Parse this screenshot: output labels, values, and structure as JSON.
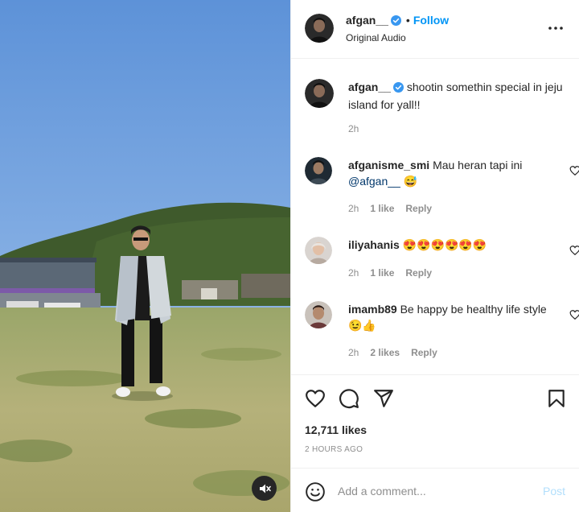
{
  "post": {
    "author": "afgan__",
    "follow_label": "Follow",
    "separator": "•",
    "audio": "Original Audio",
    "caption": "shootin somethin special in jeju island for yall!!",
    "caption_time": "2h",
    "likes": "12,711 likes",
    "posted": "2 HOURS AGO"
  },
  "comments": [
    {
      "user": "afganisme_smi",
      "text": "Mau heran tapi ini",
      "mention": "@afgan__",
      "emoji": "😅",
      "time": "2h",
      "likes": "1 like",
      "reply": "Reply"
    },
    {
      "user": "iliyahanis",
      "text": "",
      "emoji": "😍😍😍😍😍😍",
      "time": "2h",
      "likes": "1 like",
      "reply": "Reply"
    },
    {
      "user": "imamb89",
      "text": "Be happy be healthy life style",
      "emoji": "😉👍",
      "time": "2h",
      "likes": "2 likes",
      "reply": "Reply"
    }
  ],
  "composer": {
    "placeholder": "Add a comment...",
    "post_label": "Post"
  },
  "icons": {
    "more": "more-options-icon",
    "like": "heart-icon",
    "comment": "comment-icon",
    "share": "send-icon",
    "save": "bookmark-icon",
    "emoji": "emoji-icon",
    "mute": "speaker-muted-icon",
    "verified": "verified-badge-icon"
  },
  "colors": {
    "accent": "#0095f6",
    "verified": "#3897f0",
    "post_disabled": "#b2dffc"
  }
}
